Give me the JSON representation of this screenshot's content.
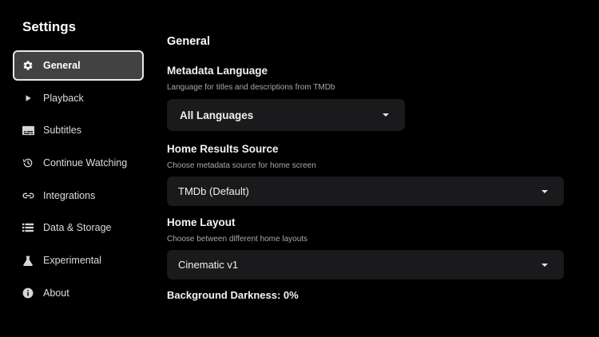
{
  "sidebar": {
    "title": "Settings",
    "items": [
      {
        "label": "General",
        "icon": "gear-icon",
        "active": true
      },
      {
        "label": "Playback",
        "icon": "play-icon",
        "active": false
      },
      {
        "label": "Subtitles",
        "icon": "subtitles-icon",
        "active": false
      },
      {
        "label": "Continue Watching",
        "icon": "history-icon",
        "active": false
      },
      {
        "label": "Integrations",
        "icon": "link-icon",
        "active": false
      },
      {
        "label": "Data & Storage",
        "icon": "list-icon",
        "active": false
      },
      {
        "label": "Experimental",
        "icon": "flask-icon",
        "active": false
      },
      {
        "label": "About",
        "icon": "info-icon",
        "active": false
      }
    ]
  },
  "main": {
    "section_title": "General",
    "metadata_language": {
      "label": "Metadata Language",
      "description": "Language for titles and descriptions from TMDb",
      "value": "All Languages"
    },
    "home_results_source": {
      "label": "Home Results Source",
      "description": "Choose metadata source for home screen",
      "value": "TMDb (Default)"
    },
    "home_layout": {
      "label": "Home Layout",
      "description": "Choose between different home layouts",
      "value": "Cinematic v1"
    },
    "background_darkness": {
      "label": "Background Darkness: 0%",
      "value_percent": 0
    }
  },
  "colors": {
    "background": "#000000",
    "active_item_bg": "#424242",
    "active_item_border": "#e8e8e8",
    "dropdown_bg": "#1a1a1c",
    "secondary_text": "#a8a8a8"
  }
}
